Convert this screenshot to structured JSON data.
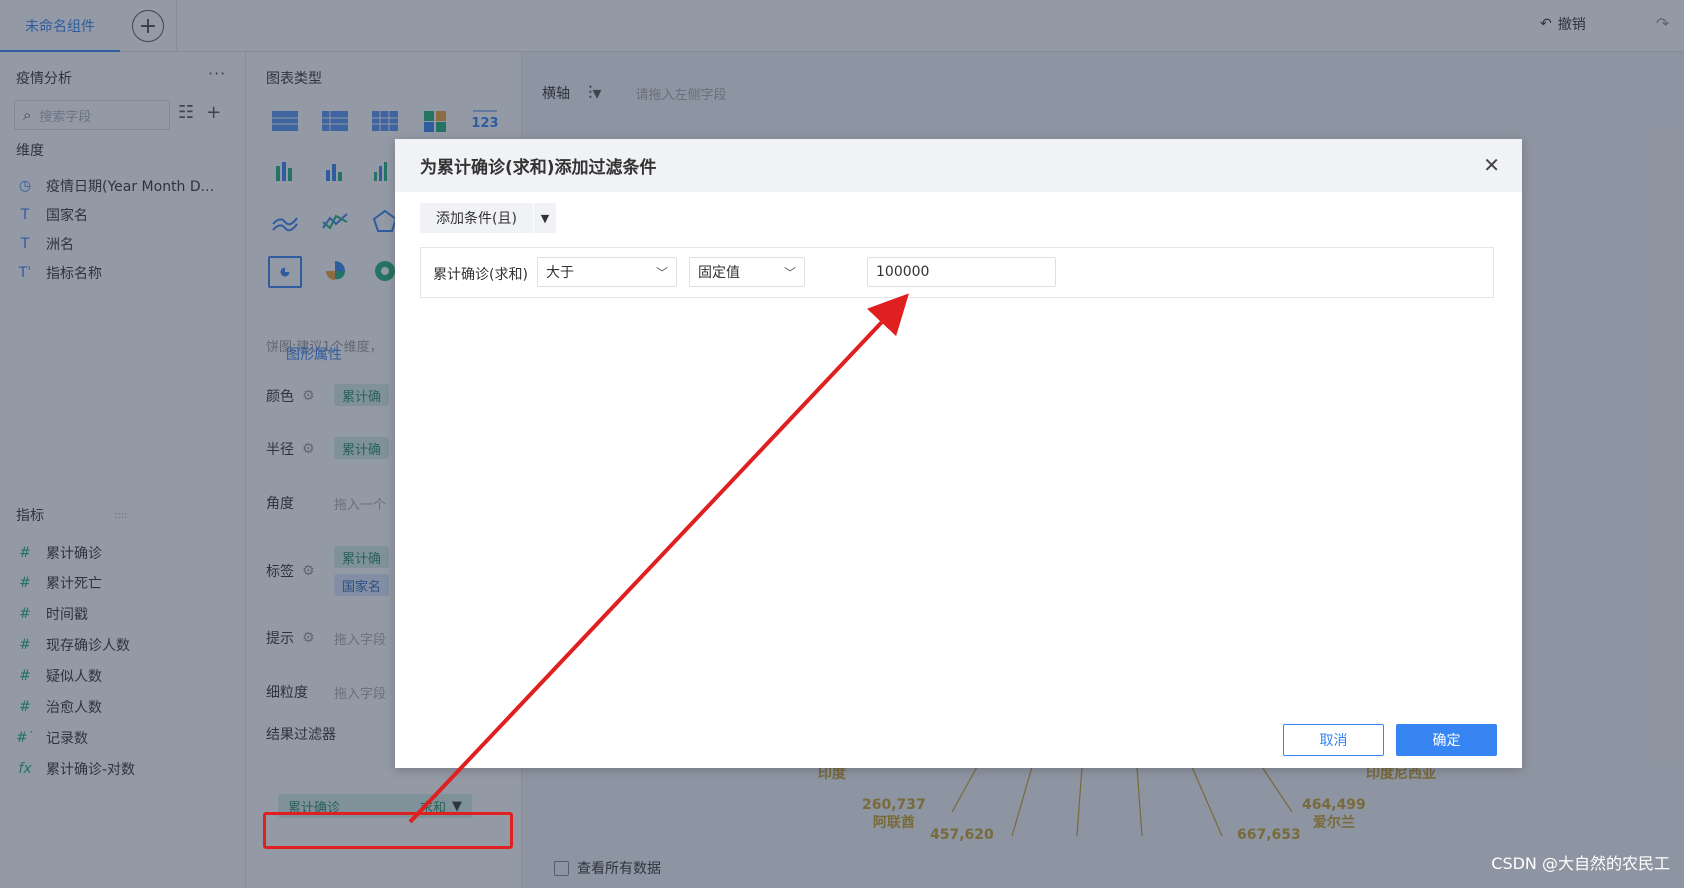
{
  "topbar": {
    "tab_label": "未命名组件",
    "undo_label": "撤销"
  },
  "left_panel": {
    "title": "疫情分析",
    "search_placeholder": "搜索字段",
    "dimensions_label": "维度",
    "dimensions": [
      {
        "label": "疫情日期(Year Month D...",
        "icon": "clock-icon"
      },
      {
        "label": "国家名",
        "icon": "text-icon"
      },
      {
        "label": "洲名",
        "icon": "text-icon"
      },
      {
        "label": "指标名称",
        "icon": "text-icon"
      }
    ],
    "measures_label": "指标",
    "measures": [
      {
        "label": "累计确诊",
        "icon": "hash-icon"
      },
      {
        "label": "累计死亡",
        "icon": "hash-icon"
      },
      {
        "label": "时间戳",
        "icon": "hash-icon"
      },
      {
        "label": "现存确诊人数",
        "icon": "hash-icon"
      },
      {
        "label": "疑似人数",
        "icon": "hash-icon"
      },
      {
        "label": "治愈人数",
        "icon": "hash-icon"
      },
      {
        "label": "记录数",
        "icon": "hash-icon"
      },
      {
        "label": "累计确诊-对数",
        "icon": "function-icon"
      }
    ]
  },
  "mid_panel": {
    "chart_type_label": "图表类型",
    "hint": "饼图:建议1个维度，",
    "tab_label": "图形属性",
    "props": {
      "color": "颜色",
      "radius": "半径",
      "angle": "角度",
      "label": "标签",
      "tooltip": "提示",
      "granularity": "细粒度"
    },
    "pills": {
      "color": "累计确",
      "radius": "累计确",
      "label_1": "累计确",
      "label_2": "国家名"
    },
    "drop_hints": {
      "angle": "拖入一个",
      "tooltip": "拖入字段",
      "granularity": "拖入字段"
    },
    "result_filter_label": "结果过滤器",
    "filter_pill": {
      "name": "累计确诊",
      "agg": "求和"
    }
  },
  "main_panel": {
    "axis_label": "横轴",
    "axis_hint": "请拖入左侧字段",
    "view_all_label": "查看所有数据",
    "pie_labels": [
      {
        "value": "",
        "name": "印度"
      },
      {
        "value": "260,737",
        "name": "阿联酋"
      },
      {
        "value": "457,620",
        "name": ""
      },
      {
        "value": "667,653",
        "name": ""
      },
      {
        "value": "464,499",
        "name": "爱尔兰"
      },
      {
        "value": "",
        "name": "印度尼西亚"
      }
    ]
  },
  "dialog": {
    "title": "为累计确诊(求和)添加过滤条件",
    "add_condition_label": "添加条件(且)",
    "condition": {
      "field": "累计确诊(求和)",
      "operator": "大于",
      "value_type": "固定值",
      "value": "100000"
    },
    "cancel_label": "取消",
    "ok_label": "确定"
  },
  "watermark": "CSDN @大自然的农民工",
  "colors": {
    "accent": "#3685f2",
    "annotation_red": "#e02020",
    "measure_green": "#23b27a",
    "pie_label_gold": "#c9a12b"
  }
}
